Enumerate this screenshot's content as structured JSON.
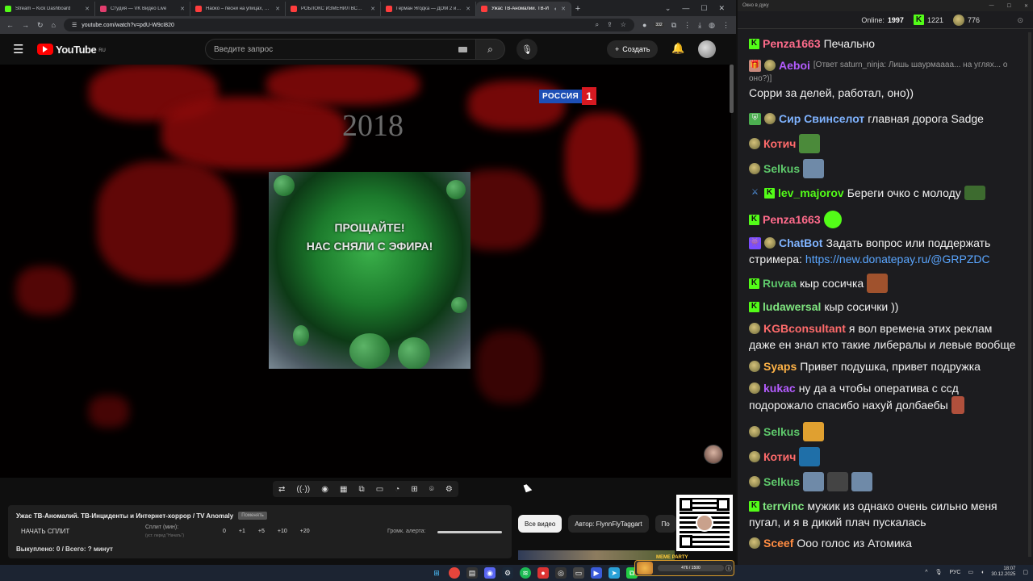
{
  "browser": {
    "tabs": [
      {
        "title": "Stream – Kick Dashboard",
        "color": "#53fc18"
      },
      {
        "title": "Студия — VK Видео Live",
        "color": "#e23d6e"
      },
      {
        "title": "Наоко – песни на улицах, арс",
        "color": "#ff3d3d"
      },
      {
        "title": "РОБЛОКС ИЗМЕНИЛ ВСЮ М",
        "color": "#ff3d3d"
      },
      {
        "title": "Герман Ягодка — ДОМ 2 и ал",
        "color": "#ff3d3d"
      },
      {
        "title": "Ужас ТВ-Аномалий. ТВ-И",
        "color": "#ff3d3d"
      }
    ],
    "url": "youtube.com/watch?v=pdU-W9cI820",
    "ext_badge": "332"
  },
  "youtube": {
    "logo_text": "YouTube",
    "logo_region": "RU",
    "search_placeholder": "Введите запрос",
    "create_label": "Создать"
  },
  "video": {
    "year": "2018",
    "channel_word": "РОССИЯ",
    "channel_num": "1",
    "line1": "ПРОЩАЙТЕ!",
    "line2": "НАС СНЯЛИ С ЭФИРА!"
  },
  "split": {
    "title": "Ужас ТВ-Аномалий. ТВ-Инциденты и Интернет-хоррор / TV Anomaly",
    "chip": "Поменять",
    "start": "НАЧАТЬ СПЛИТ",
    "label": "Сплит (мин):",
    "sub": "(уст. перед \"Начать\")",
    "values": [
      "0",
      "+1",
      "+5",
      "+10",
      "+20"
    ],
    "alert_label": "Громк. алерта:",
    "bought": "Выкуплено: 0 / Всего: ? минут"
  },
  "filters": [
    "Все видео",
    "Автор: FlynnFlyTaggart",
    "По"
  ],
  "chat": {
    "window_title": "Окно в дуку",
    "online_label": "Online:",
    "online": "1997",
    "kick_count": "1221",
    "other_count": "776",
    "messages": [
      {
        "user": "Penza1663",
        "color": "#ff6b8b",
        "text": "Печально"
      },
      {
        "user": "Aeboi",
        "color": "#b45cff",
        "reply": "[Ответ saturn_ninja: Лишь шаурмаааа... на углях... оно?)]",
        "text": "Сорри за делей, работал, оно))"
      },
      {
        "user": "Сир Свинселот",
        "color": "#7fb3ff",
        "text": "главная дорога Sadge"
      },
      {
        "user": "Котич",
        "color": "#ff6b6b",
        "text": ""
      },
      {
        "user": "Selkus",
        "color": "#5ec96b",
        "text": ""
      },
      {
        "user": "lev_majorov",
        "color": "#53fc18",
        "text": "Береги очко с молоду"
      },
      {
        "user": "Penza1663",
        "color": "#ff6b8b",
        "text": ""
      },
      {
        "user": "ChatBot",
        "color": "#7fb3ff",
        "text": "Задать вопрос или поддержать",
        "text2": "стримера:",
        "link": "https://new.donatepay.ru/@GRPZDC"
      },
      {
        "user": "Ruvaa",
        "color": "#5ec96b",
        "text": "кыр сосичка"
      },
      {
        "user": "ludawersal",
        "color": "#7fe57f",
        "text": "кыр сосички ))"
      },
      {
        "user": "KGBconsultant",
        "color": "#ff6b6b",
        "text": "я вол времена этих реклам",
        "text2": "даже ен знал кто такие либералы и левые вообще"
      },
      {
        "user": "Syaps",
        "color": "#ffb347",
        "text": "Привет подушка, привет подружка"
      },
      {
        "user": "kukac",
        "color": "#b45cff",
        "text": "ну да а чтобы оператива с ссд",
        "text2": "подорожало  спасибо нахуй долбаебы"
      },
      {
        "user": "Selkus",
        "color": "#5ec96b",
        "text": ""
      },
      {
        "user": "Котич",
        "color": "#ff6b6b",
        "text": ""
      },
      {
        "user": "Selkus",
        "color": "#5ec96b",
        "text": ""
      },
      {
        "user": "terrvinc",
        "color": "#7fe57f",
        "text": "мужик из однако очень сильно меня",
        "text2": "пугал, и я в дикий плач пускалась"
      },
      {
        "user": "Sceef",
        "color": "#ff8c42",
        "text": "Ооо голос из Атомика"
      }
    ]
  },
  "taskbar": {
    "party_label": "МЕМЕ PARTY",
    "party_progress": "476 / 1500",
    "lang": "РУС",
    "time": "18:07",
    "date": "30.12.2025"
  }
}
